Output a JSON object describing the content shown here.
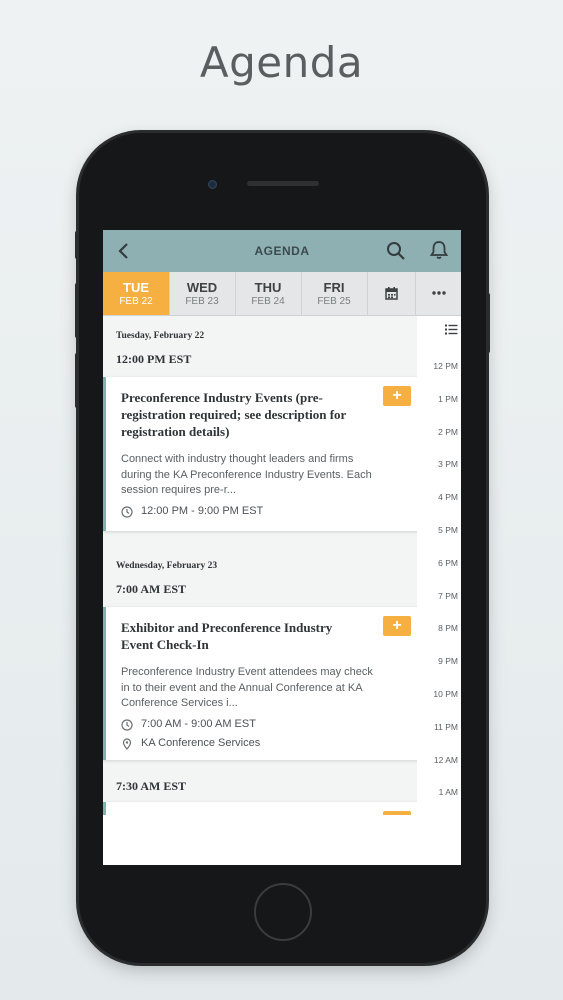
{
  "hero": {
    "title": "Agenda"
  },
  "header": {
    "title": "AGENDA",
    "back_icon": "chevron-left-icon",
    "search_icon": "search-icon",
    "bell_icon": "bell-icon"
  },
  "days": [
    {
      "day": "TUE",
      "date": "FEB 22",
      "active": true
    },
    {
      "day": "WED",
      "date": "FEB 23",
      "active": false
    },
    {
      "day": "THU",
      "date": "FEB 24",
      "active": false
    },
    {
      "day": "FRI",
      "date": "FEB 25",
      "active": false
    }
  ],
  "toolbar": {
    "calendar_icon": "calendar-icon",
    "more_icon": "more-icon",
    "list_icon": "list-icon"
  },
  "timeline": [
    "12 PM",
    "1 PM",
    "2 PM",
    "3 PM",
    "4 PM",
    "5 PM",
    "6 PM",
    "7 PM",
    "8 PM",
    "9 PM",
    "10 PM",
    "11 PM",
    "12 AM",
    "1 AM"
  ],
  "groups": [
    {
      "date": "Tuesday, February 22",
      "time": "12:00 PM EST"
    },
    {
      "date": "Wednesday, February 23",
      "time": "7:00 AM EST"
    },
    {
      "date": "",
      "time": "7:30 AM EST"
    }
  ],
  "sessions": [
    {
      "title": "Preconference Industry Events (pre-registration required; see description for registration details)",
      "description": "Connect with industry thought leaders and firms during the KA Preconference Industry Events. Each session requires pre-r...",
      "time": "12:00 PM - 9:00 PM EST",
      "location": "",
      "add_label": "+"
    },
    {
      "title": "Exhibitor and Preconference Industry Event Check-In",
      "description": "Preconference Industry Event attendees may check in to their event and the Annual Conference at KA Conference Services i...",
      "time": "7:00 AM - 9:00 AM EST",
      "location": "KA Conference Services",
      "add_label": "+"
    }
  ],
  "colors": {
    "accent": "#f5b041",
    "header": "#8fb0b3",
    "card_border": "#7fb3b0"
  }
}
